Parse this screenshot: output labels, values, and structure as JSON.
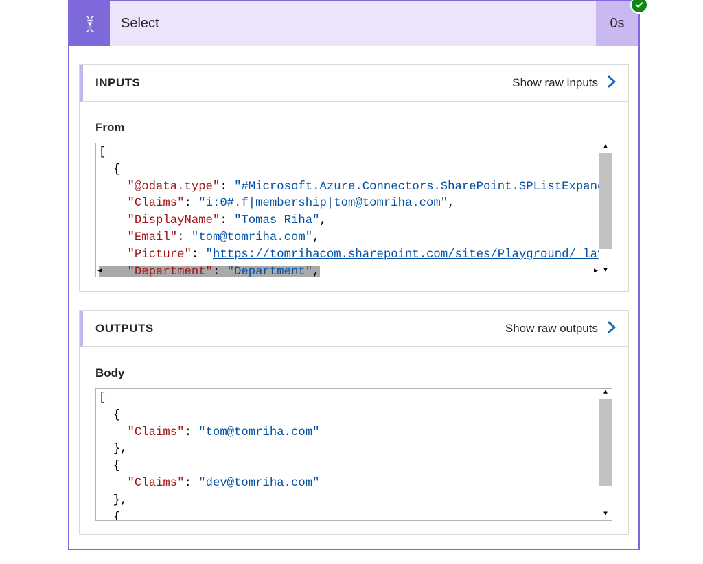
{
  "header": {
    "title": "Select",
    "duration": "0s"
  },
  "inputs": {
    "panel_title": "INPUTS",
    "link_label": "Show raw inputs",
    "field_label": "From",
    "json_lines": {
      "l0": "[",
      "l1": "  {",
      "k_odata": "\"@odata.type\"",
      "v_odata": "\"#Microsoft.Azure.Connectors.SharePoint.SPListExpand",
      "k_claims": "\"Claims\"",
      "v_claims": "\"i:0#.f|membership|tom@tomriha.com\"",
      "k_display": "\"DisplayName\"",
      "v_display": "\"Tomas Riha\"",
      "k_email": "\"Email\"",
      "v_email": "\"tom@tomriha.com\"",
      "k_picture": "\"Picture\"",
      "v_picture": "https://tomrihacom.sharepoint.com/sites/Playground/_lay",
      "k_dept": "\"Department\"",
      "v_dept": "\"Department\""
    }
  },
  "outputs": {
    "panel_title": "OUTPUTS",
    "link_label": "Show raw outputs",
    "field_label": "Body",
    "json_lines": {
      "l0": "[",
      "l1": "  {",
      "k_claims": "\"Claims\"",
      "v_claims1": "\"tom@tomriha.com\"",
      "l3": "  },",
      "l4": "  {",
      "v_claims2": "\"dev@tomriha.com\"",
      "l6": "  },",
      "l7": "  {"
    }
  }
}
